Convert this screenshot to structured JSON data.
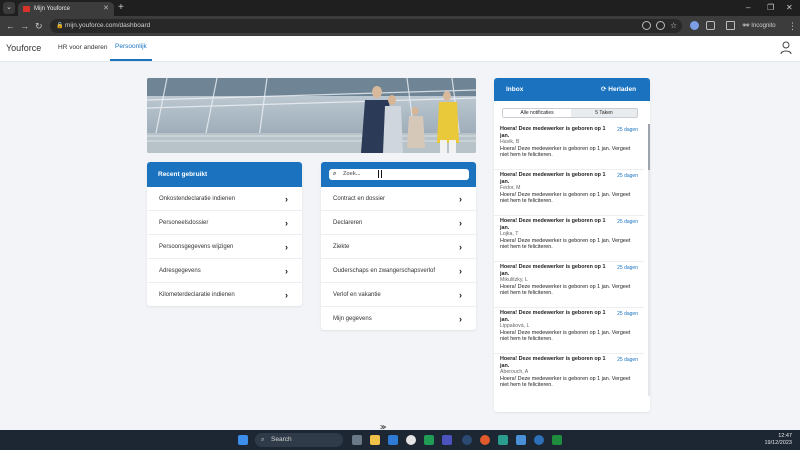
{
  "browser": {
    "tab_title": "Mijn Youforce",
    "url": "mijn.youforce.com/dashboard",
    "profile_label": "Incognito",
    "window_controls": [
      "–",
      "❐",
      "✕"
    ],
    "icons": [
      "back-icon",
      "forward-icon",
      "reload-icon",
      "lock-icon",
      "star-icon",
      "extensions-icon",
      "sidepanel-icon",
      "incognito-icon",
      "menu-icon"
    ]
  },
  "header": {
    "logo": "Youforce",
    "nav": [
      {
        "label": "HR voor anderen",
        "active": false
      },
      {
        "label": "Persoonlijk",
        "active": true
      }
    ],
    "accent_color": "#1b73c0"
  },
  "recent": {
    "title": "Recent gebruikt",
    "items": [
      "Onkostendeclaratie indienen",
      "Personeelsdossier",
      "Persoonsgegevens wijzigen",
      "Adresgegevens",
      "Kilometerdeclaratie indienen"
    ]
  },
  "search": {
    "placeholder": "Zoek...",
    "items": [
      "Contract en dossier",
      "Declareren",
      "Ziekte",
      "Ouderschaps en zwangerschapsverlof",
      "Verlof en vakantie",
      "Mijn gegevens"
    ]
  },
  "inbox": {
    "title": "Inbox",
    "reload_label": "Herladen",
    "tabs": [
      "Alle notificaties",
      "5 Taken"
    ],
    "messages": [
      {
        "title": "Hoera! Deze medewerker is geboren op 1 jan.",
        "date": "25 dagen",
        "name": "Havik, B",
        "body": "Hoera! Deze medewerker is geboren op 1 jan. Vergeet niet hem te feliciteren."
      },
      {
        "title": "Hoera! Deze medewerker is geboren op 1 jan.",
        "date": "25 dagen",
        "name": "Fedor, M",
        "body": "Hoera! Deze medewerker is geboren op 1 jan. Vergeet niet hem te feliciteren."
      },
      {
        "title": "Hoera! Deze medewerker is geboren op 1 jan.",
        "date": "25 dagen",
        "name": "Lojka, T",
        "body": "Hoera! Deze medewerker is geboren op 1 jan. Vergeet niet hem te feliciteren."
      },
      {
        "title": "Hoera! Deze medewerker is geboren op 1 jan.",
        "date": "25 dagen",
        "name": "Mikulitzky, L",
        "body": "Hoera! Deze medewerker is geboren op 1 jan. Vergeet niet hem te feliciteren."
      },
      {
        "title": "Hoera! Deze medewerker is geboren op 1 jan.",
        "date": "25 dagen",
        "name": "Lippaková, L",
        "body": "Hoera! Deze medewerker is geboren op 1 jan. Vergeet niet hem te feliciteren."
      },
      {
        "title": "Hoera! Deze medewerker is geboren op 1 jan.",
        "date": "25 dagen",
        "name": "Aberouch, A",
        "body": "Hoera! Deze medewerker is geboren op 1 jan. Vergeet niet hem te feliciteren."
      }
    ]
  },
  "taskbar": {
    "search_label": "Search",
    "time": "12:47",
    "date": "19/12/2023"
  }
}
